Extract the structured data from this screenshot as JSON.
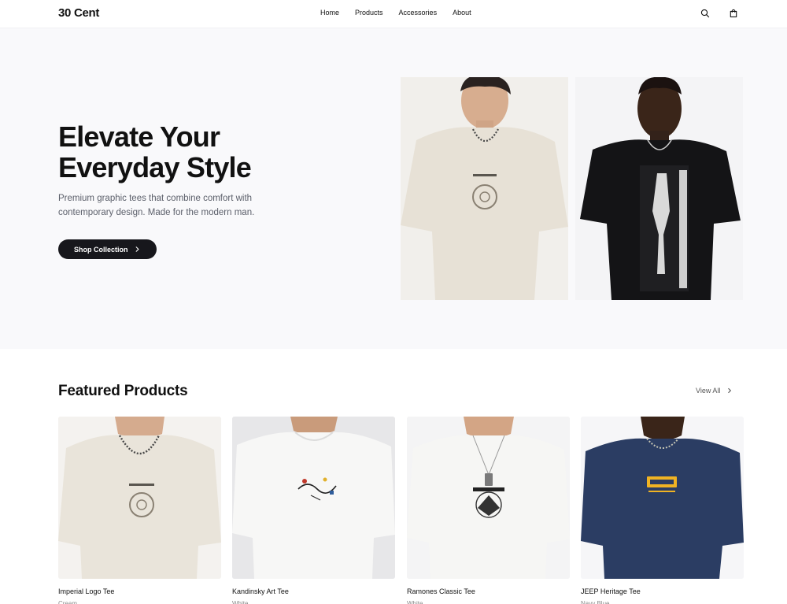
{
  "header": {
    "logo": "30 Cent",
    "nav": [
      "Home",
      "Products",
      "Accessories",
      "About"
    ]
  },
  "hero": {
    "title_line1": "Elevate Your",
    "title_line2": "Everyday Style",
    "subtitle": "Premium graphic tees that combine comfort with contemporary design. Made for the modern man.",
    "button_label": "Shop Collection"
  },
  "featured": {
    "title": "Featured Products",
    "view_all": "View All",
    "products": [
      {
        "name": "Imperial Logo Tee",
        "color": "Cream",
        "print": "imperial-logo",
        "shirt_color": "#e9e4da"
      },
      {
        "name": "Kandinsky Art Tee",
        "color": "White",
        "print": "kandinsky-art",
        "shirt_color": "#f7f7f6"
      },
      {
        "name": "Ramones Classic Tee",
        "color": "White",
        "print": "ramones-seal",
        "shirt_color": "#f6f6f4"
      },
      {
        "name": "JEEP Heritage Tee",
        "color": "Navy Blue",
        "print": "jeep-wordmark",
        "shirt_color": "#2b3d63"
      }
    ]
  },
  "theme": {
    "accent": "#17171c",
    "hero_bg": "#f9f9fb",
    "muted_text": "#5b5f6a"
  },
  "icons": {
    "search": "search-icon",
    "cart": "shopping-bag-icon",
    "chevron": "chevron-right-icon"
  }
}
